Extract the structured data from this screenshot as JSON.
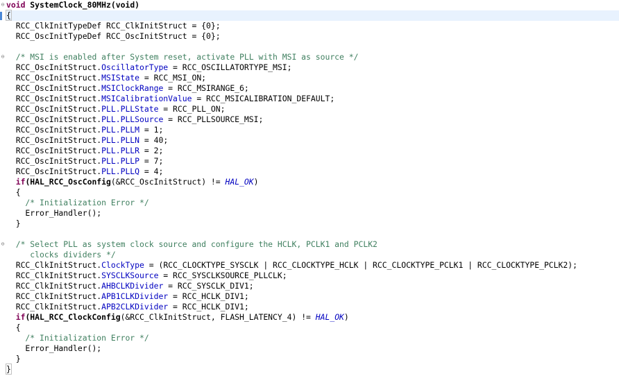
{
  "code": {
    "l1_kw": "void",
    "l1_fn": "SystemClock_80MHz",
    "l1_rest": "(void)",
    "l2": "{",
    "l3": "  RCC_ClkInitTypeDef RCC_ClkInitStruct = {0};",
    "l4": "  RCC_OscInitTypeDef RCC_OscInitStruct = {0};",
    "l6": "  /* MSI is enabled after System reset, activate PLL with MSI as source */",
    "l7_a": "  RCC_OscInitStruct.",
    "l7_f": "OscillatorType",
    "l7_b": " = RCC_OSCILLATORTYPE_MSI;",
    "l8_a": "  RCC_OscInitStruct.",
    "l8_f": "MSIState",
    "l8_b": " = RCC_MSI_ON;",
    "l9_a": "  RCC_OscInitStruct.",
    "l9_f": "MSIClockRange",
    "l9_b": " = RCC_MSIRANGE_6;",
    "l10_a": "  RCC_OscInitStruct.",
    "l10_f": "MSICalibrationValue",
    "l10_b": " = RCC_MSICALIBRATION_DEFAULT;",
    "l11_a": "  RCC_OscInitStruct.",
    "l11_f": "PLL.PLLState",
    "l11_b": " = RCC_PLL_ON;",
    "l12_a": "  RCC_OscInitStruct.",
    "l12_f": "PLL.PLLSource",
    "l12_b": " = RCC_PLLSOURCE_MSI;",
    "l13_a": "  RCC_OscInitStruct.",
    "l13_f": "PLL.PLLM",
    "l13_b": " = 1;",
    "l14_a": "  RCC_OscInitStruct.",
    "l14_f": "PLL.PLLN",
    "l14_b": " = 40;",
    "l15_a": "  RCC_OscInitStruct.",
    "l15_f": "PLL.PLLR",
    "l15_b": " = 2;",
    "l16_a": "  RCC_OscInitStruct.",
    "l16_f": "PLL.PLLP",
    "l16_b": " = 7;",
    "l17_a": "  RCC_OscInitStruct.",
    "l17_f": "PLL.PLLQ",
    "l17_b": " = 4;",
    "l18_kw": "  if",
    "l18_fn": "(HAL_RCC_OscConfig",
    "l18_b": "(&RCC_OscInitStruct) != ",
    "l18_m": "HAL_OK",
    "l18_c": ")",
    "l19": "  {",
    "l20": "    /* Initialization Error */",
    "l21": "    Error_Handler();",
    "l22": "  }",
    "l24": "  /* Select PLL as system clock source and configure the HCLK, PCLK1 and PCLK2",
    "l25": "     clocks dividers */",
    "l26_a": "  RCC_ClkInitStruct.",
    "l26_f": "ClockType",
    "l26_b": " = (RCC_CLOCKTYPE_SYSCLK | RCC_CLOCKTYPE_HCLK | RCC_CLOCKTYPE_PCLK1 | RCC_CLOCKTYPE_PCLK2);",
    "l27_a": "  RCC_ClkInitStruct.",
    "l27_f": "SYSCLKSource",
    "l27_b": " = RCC_SYSCLKSOURCE_PLLCLK;",
    "l28_a": "  RCC_ClkInitStruct.",
    "l28_f": "AHBCLKDivider",
    "l28_b": " = RCC_SYSCLK_DIV1;",
    "l29_a": "  RCC_ClkInitStruct.",
    "l29_f": "APB1CLKDivider",
    "l29_b": " = RCC_HCLK_DIV1;",
    "l30_a": "  RCC_ClkInitStruct.",
    "l30_f": "APB2CLKDivider",
    "l30_b": " = RCC_HCLK_DIV1;",
    "l31_kw": "  if",
    "l31_fn": "(HAL_RCC_ClockConfig",
    "l31_b": "(&RCC_ClkInitStruct, FLASH_LATENCY_4) != ",
    "l31_m": "HAL_OK",
    "l31_c": ")",
    "l32": "  {",
    "l33": "    /* Initialization Error */",
    "l34": "    Error_Handler();",
    "l35": "  }",
    "l36": "}"
  },
  "fold_markers": {
    "collapse": "⊖"
  },
  "colors": {
    "keyword": "#7f0055",
    "field": "#0000c0",
    "comment": "#3f7f5f",
    "current_line": "#e8f2fe"
  }
}
